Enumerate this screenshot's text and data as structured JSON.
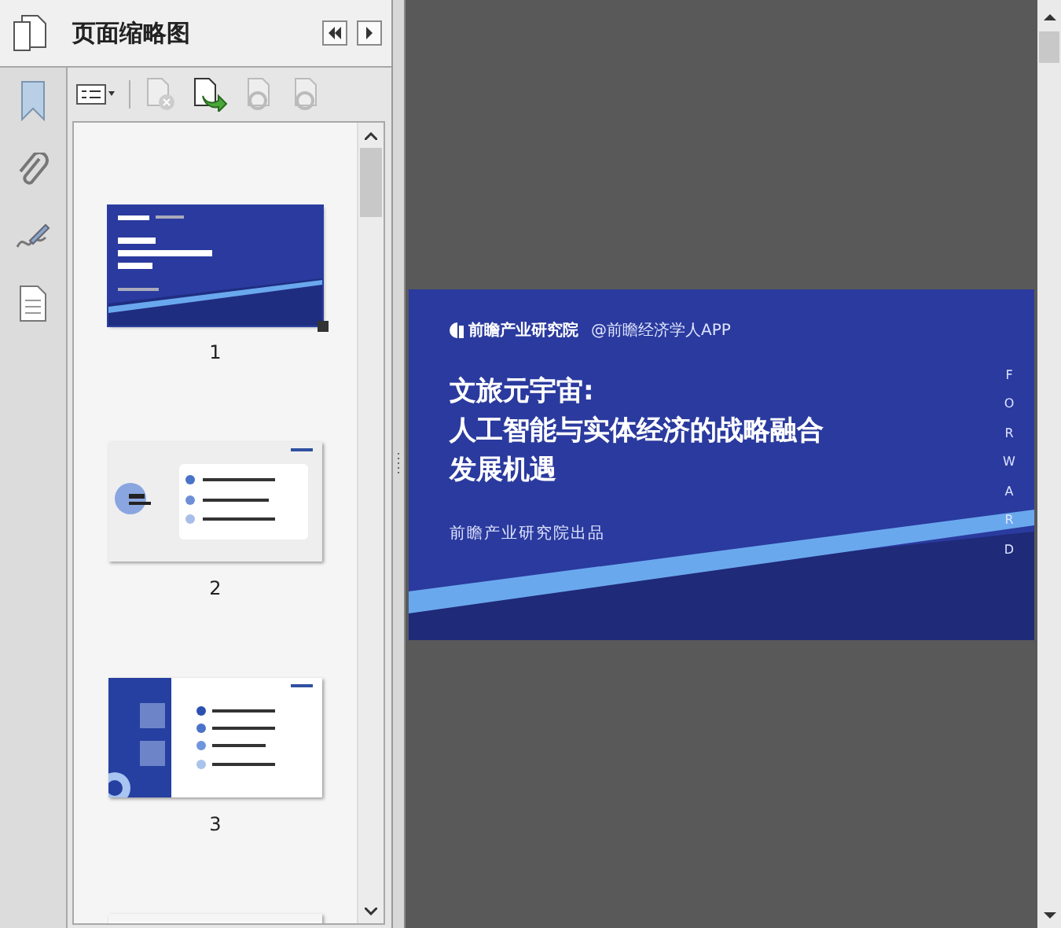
{
  "panel": {
    "title": "页面缩略图"
  },
  "thumbnails": [
    {
      "number": "1",
      "kind": "cover",
      "selected": true
    },
    {
      "number": "2",
      "kind": "contents",
      "selected": false
    },
    {
      "number": "3",
      "kind": "section",
      "selected": false
    },
    {
      "kind": "partial",
      "selected": false
    }
  ],
  "page": {
    "logo": "前瞻产业研究院",
    "handle": "@前瞻经济学人APP",
    "title_lines": [
      "文旅元宇宙:",
      "人工智能与实体经济的战略融合",
      "发展机遇"
    ],
    "publisher": "前瞻产业研究院出品",
    "side_text": "FORWARD"
  }
}
